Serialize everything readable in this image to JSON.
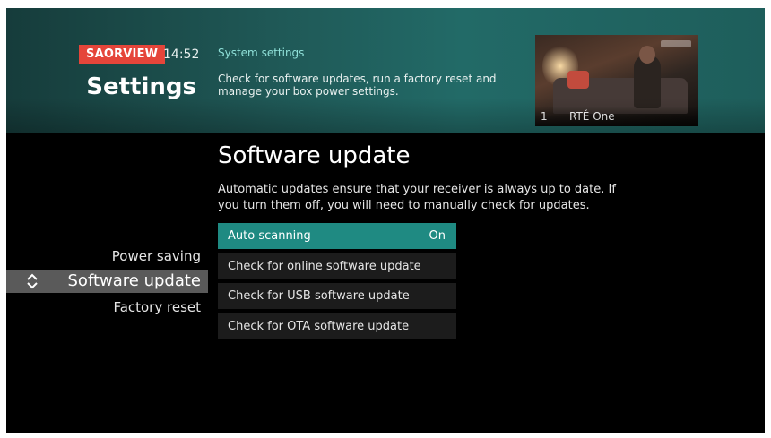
{
  "header": {
    "brand": "SAORVIEW",
    "time": "14:52",
    "page_title": "Settings",
    "breadcrumb": "System settings",
    "description": "Check for software updates, run a factory reset and manage your box power settings."
  },
  "preview": {
    "channel_number": "1",
    "channel_name": "RTÉ One"
  },
  "sidebar": {
    "items": [
      {
        "label": "Power saving"
      },
      {
        "label": "Software update",
        "selected": true
      },
      {
        "label": "Factory reset"
      }
    ]
  },
  "main": {
    "title": "Software update",
    "description": "Automatic updates ensure that your receiver is always up to date. If you turn them off, you will need to manually check for updates.",
    "options": [
      {
        "label": "Auto scanning",
        "value": "On",
        "active": true
      },
      {
        "label": "Check for online software update"
      },
      {
        "label": "Check for USB software update"
      },
      {
        "label": "Check for OTA software update"
      }
    ]
  },
  "colors": {
    "accent": "#1f8a82",
    "brand": "#e5453a",
    "selected_bg": "#5a5a5a"
  },
  "icons": {
    "updown": "up-down-chevron-icon"
  }
}
